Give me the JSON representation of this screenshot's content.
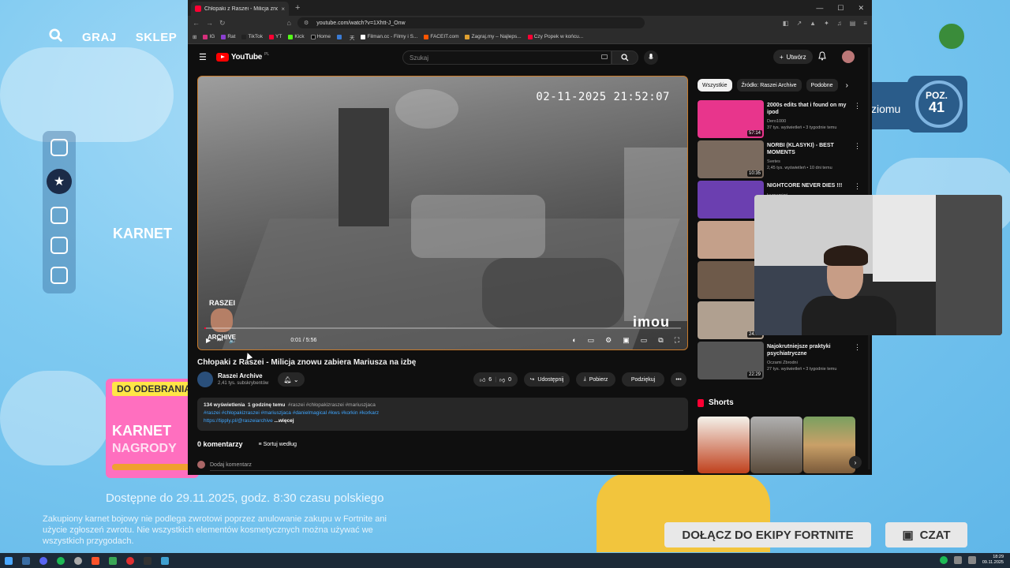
{
  "game": {
    "nav": {
      "play": "GRAJ",
      "shop": "SKLEP"
    },
    "karnet_label": "KARNET",
    "promo": {
      "tag": "DO ODEBRANIA",
      "title": "KARNET",
      "subtitle": "NAGRODY"
    },
    "available": "Dostępne do 29.11.2025, godz. 8:30 czasu polskiego",
    "fine_print": "Zakupiony karnet bojowy nie podlega zwrotowi poprzez anulowanie zakupu w Fortnite ani użycie zgłoszeń zwrotu. Nie wszystkich elementów kosmetycznych można używać we wszystkich przygodach.",
    "level_side": "ziomu",
    "level_label": "POZ.",
    "level_value": "41",
    "join_button": "DOŁĄCZ DO EKIPY FORTNITE",
    "chat_button": "CZAT"
  },
  "browser": {
    "tab_title": "Chłopaki z Raszei - Milicja znow",
    "url": "youtube.com/watch?v=1Xhtt-J_Onw",
    "bookmarks": [
      "IG",
      "Rat",
      "TikTok",
      "YT",
      "Kick",
      "Home",
      "",
      "天",
      "Filman.cc - Filmy i S...",
      "FACEIT.com",
      "Zagraj.my – Najleps...",
      "Czy Popek w końcu..."
    ]
  },
  "youtube": {
    "logo": "YouTube",
    "region": "PL",
    "search_placeholder": "Szukaj",
    "create_label": "Utwórz",
    "video": {
      "timestamp_overlay": "02-11-2025 21:52:07",
      "watermark": "imou",
      "channel_overlay": "RASZEI",
      "channel_overlay_sub": "ARCHIVE",
      "time": "0:01 / 5:56",
      "progress": 0.003,
      "title": "Chłopaki z Raszei - Milicja znowu zabiera Mariusza na izbę"
    },
    "channel": {
      "name": "Raszei Archive",
      "subs": "2,41 tys. subskrybentów"
    },
    "actions": {
      "likes": "6",
      "dislikes": "0",
      "share": "Udostępnij",
      "download": "Pobierz",
      "thanks": "Podziękuj"
    },
    "description": {
      "views": "134 wyświetlenia",
      "date": "1 godzinę temu",
      "tags_inline": "#raszei #chłopakizraszei #mariuszjaca",
      "tags": "#raszei #chłopakizraszei #mariuszjaca #danielmagical #kws #korkin #korkarz",
      "link": "https://tipply.pl/@raszeiarchive",
      "more": "...więcej"
    },
    "comments": {
      "count": "0 komentarzy",
      "sort": "Sortuj według",
      "add": "Dodaj komentarz"
    },
    "chips": [
      "Wszystkie",
      "Źródło: Raszei Archive",
      "Podobne"
    ],
    "recommendations": [
      {
        "title": "2000s edits that i found on my ipod",
        "channel": "Dero1000",
        "meta": "37 tys. wyświetleń • 3 tygodnie temu",
        "duration": "57:14",
        "color": "#e8358c"
      },
      {
        "title": "NORBI (KLASYKI) - BEST MOMENTS",
        "channel": "Svetes",
        "meta": "2,45 tys. wyświetleń • 10 dni temu",
        "duration": "10:35",
        "color": "#7a6a5e"
      },
      {
        "title": "NIGHTCORE NEVER DIES !!!",
        "channel": "luvmamimi",
        "meta": "",
        "duration": "",
        "color": "#6b3fb0"
      },
      {
        "title": "",
        "channel": "",
        "meta": "",
        "duration": "",
        "color": "#c4a08a"
      },
      {
        "title": "",
        "channel": "",
        "meta": "",
        "duration": "",
        "color": "#6e5a4a"
      },
      {
        "title": "",
        "channel": "",
        "meta": "",
        "duration": "24:35",
        "color": "#b0a090"
      },
      {
        "title": "Najokrutniejsze praktyki psychiatryczne",
        "channel": "Oczami Zbrodni",
        "meta": "27 tys. wyświetleń • 3 tygodnie temu",
        "duration": "22:29",
        "color": "#555555"
      }
    ],
    "shorts_label": "Shorts"
  },
  "taskbar": {
    "time": "18:29",
    "date": "09.11.2025"
  }
}
